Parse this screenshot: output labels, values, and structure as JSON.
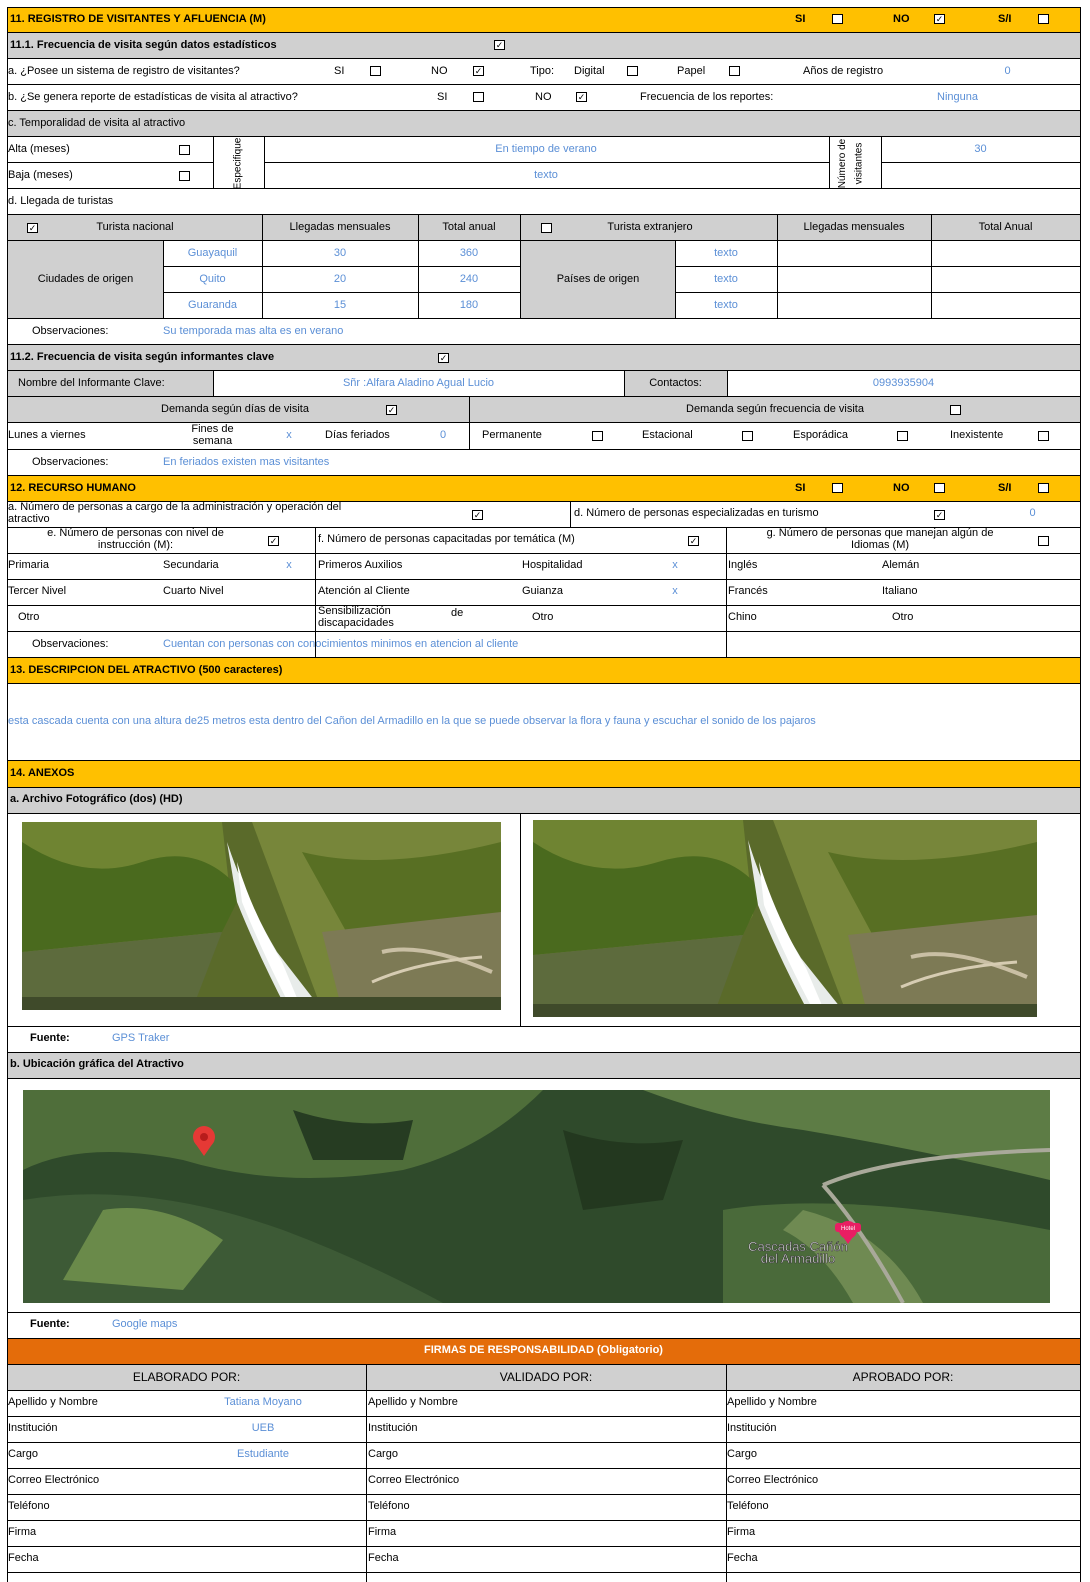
{
  "s11": {
    "title": "11. REGISTRO DE VISITANTES Y AFLUENCIA (M)",
    "si": "SI",
    "no": "NO",
    "sa": "S/I",
    "s111": "11.1. Frecuencia de visita según datos estadísticos",
    "a_q": "a. ¿Posee un sistema de registro de visitantes?",
    "si_l": "SI",
    "no_l": "NO",
    "tipo": "Tipo:",
    "digital": "Digital",
    "papel": "Papel",
    "anos": "Años de registro",
    "anos_val": "0",
    "b_q": "b. ¿Se genera reporte de estadísticas de visita al atractivo?",
    "frec_rep": "Frecuencia de los reportes:",
    "frec_rep_val": "Ninguna",
    "c_q": "c. Temporalidad de visita al atractivo",
    "alta": "Alta (meses)",
    "baja": "Baja (meses)",
    "especifique": "Especifique",
    "alta_val": "En tiempo de verano",
    "baja_val": "texto",
    "num_vis_1": "Número de",
    "num_vis_2": "visitantes",
    "num_vis_val": "30",
    "d_q": "d. Llegada de turistas",
    "tur_nac": "Turista nacional",
    "lleg_mens": "Llegadas mensuales",
    "total_anual": "Total anual",
    "tur_ext": "Turista extranjero",
    "lleg_mens2": "Llegadas mensuales",
    "total_anual2": "Total Anual",
    "ciudades": "Ciudades de origen",
    "paises": "Países de origen",
    "cities": [
      {
        "name": "Guayaquil",
        "m": "30",
        "t": "360"
      },
      {
        "name": "Quito",
        "m": "20",
        "t": "240"
      },
      {
        "name": "Guaranda",
        "m": "15",
        "t": "180"
      }
    ],
    "countries": [
      "texto",
      "texto",
      "texto"
    ],
    "obs": "Observaciones:",
    "obs_val": "Su temporada mas alta es en verano",
    "s112": "11.2. Frecuencia de visita según informantes clave",
    "informante": "Nombre del Informante Clave:",
    "informante_val": "Sñr :Alfara Aladino Agual Lucio",
    "contactos": "Contactos:",
    "contactos_val": "0993935904",
    "dem_dias": "Demanda según  días de visita",
    "dem_frec": "Demanda según frecuencia de visita",
    "lunes": "Lunes a viernes",
    "fines1": "Fines de",
    "fines2": "semana",
    "fines_val": "x",
    "feriados": "Días feriados",
    "feriados_val": "0",
    "permanente": "Permanente",
    "estacional": "Estacional",
    "esporadica": "Esporádica",
    "inexistente": "Inexistente",
    "obs2": "Observaciones:",
    "obs2_val": "En feriados existen mas visitantes"
  },
  "s12": {
    "title": "12. RECURSO HUMANO",
    "si": "SI",
    "no": "NO",
    "sa": "S/I",
    "a_1": "a. Número  de  personas  a  cargo  de  la  administración  y  operación  del",
    "a_2": "atractivo",
    "d_q": "d. Número de personas especializadas en turismo",
    "d_val": "0",
    "e_1": "e. Número de personas con nivel de",
    "e_2": "instrucción (M):",
    "f_q": "f. Número de personas capacitadas por temática (M)",
    "g_1": "g. Número de personas que manejan algún de",
    "g_2": "Idiomas (M)",
    "primaria": "Primaria",
    "secundaria": "Secundaria",
    "secundaria_val": "x",
    "tercer": "Tercer Nivel",
    "cuarto": "Cuarto Nivel",
    "otro1": "Otro",
    "primeros": "Primeros Auxilios",
    "hospitalidad": "Hospitalidad",
    "hospitalidad_val": "x",
    "atencion": "Atención al Cliente",
    "guianza": "Guianza",
    "guianza_val": "x",
    "sens_1": "Sensibilización",
    "sens_de": "de",
    "sens_2": "discapacidades",
    "otro2": "Otro",
    "ingles": "Inglés",
    "aleman": "Alemán",
    "frances": "Francés",
    "italiano": "Italiano",
    "chino": "Chino",
    "otro3": "Otro",
    "obs": "Observaciones:",
    "obs_val": "Cuentan con personas  con conocimientos minimos en atencion al cliente"
  },
  "s13": {
    "title": "13. DESCRIPCION DEL ATRACTIVO (500 caracteres)",
    "text": "esta cascada cuenta con una altura de25 metros esta  dentro del  Cañon del Armadillo en la que se puede observar la flora y fauna y escuchar el  sonido  de los  pajaros"
  },
  "s14": {
    "title": "14. ANEXOS",
    "a": "a. Archivo Fotográfico (dos) (HD)",
    "fuente": "Fuente:",
    "fuente_val": "GPS Traker",
    "b": "b. Ubicación gráfica del Atractivo",
    "map_badge": "Hotel",
    "map_label_1": "Cascadas Cañón",
    "map_label_2": "del Armadillo",
    "fuente2": "Fuente:",
    "fuente2_val": "Google maps"
  },
  "firmas": {
    "title": "FIRMAS DE RESPONSABILIDAD (Obligatorio)",
    "elaborado": "ELABORADO POR:",
    "validado": "VALIDADO  POR:",
    "aprobado": "APROBADO POR:",
    "rows": [
      "Apellido y Nombre",
      "Institución",
      "Cargo",
      "Correo Electrónico",
      "Teléfono",
      "Firma",
      "Fecha"
    ],
    "elab_vals": [
      "Tatiana Moyano",
      "UEB",
      "Estudiante"
    ]
  },
  "colors": {
    "header": "#ffc000",
    "subheader": "#d0d0d0",
    "firmas": "#e46c0a",
    "value": "#5b8fd6"
  }
}
